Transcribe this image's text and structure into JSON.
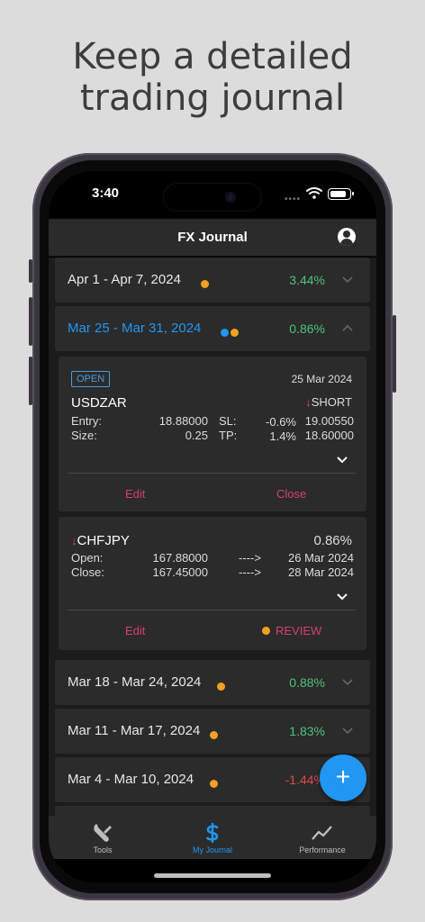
{
  "headline": {
    "line1": "Keep a detailed",
    "line2": "trading journal"
  },
  "status": {
    "time": "3:40"
  },
  "app": {
    "title": "FX Journal"
  },
  "colors": {
    "accent": "#2196f3",
    "positive": "#4ec27a",
    "negative": "#e04848",
    "pending": "#f5a020",
    "action": "#d6406e"
  },
  "weeks": [
    {
      "label": "Apr 1 - Apr 7, 2024",
      "pct": "3.44%",
      "dots": [
        "#f5a020"
      ],
      "expanded": false
    },
    {
      "label": "Mar 25 - Mar 31, 2024",
      "pct": "0.86%",
      "dots": [
        "#2196f3",
        "#f5a020"
      ],
      "expanded": true
    },
    {
      "label": "Mar 18 - Mar 24, 2024",
      "pct": "0.88%",
      "dots": [
        "#f5a020"
      ],
      "expanded": false
    },
    {
      "label": "Mar 11 - Mar 17, 2024",
      "pct": "1.83%",
      "dots": [
        "#f5a020"
      ],
      "expanded": false
    },
    {
      "label": "Mar 4 - Mar 10, 2024",
      "pct": "-1.44%",
      "dots": [
        "#f5a020"
      ],
      "expanded": false
    }
  ],
  "open_trade": {
    "badge": "OPEN",
    "date": "25 Mar 2024",
    "pair": "USDZAR",
    "direction": "SHORT",
    "entry_label": "Entry:",
    "entry": "18.88000",
    "size_label": "Size:",
    "size": "0.25",
    "sl_label": "SL:",
    "sl_pct": "-0.6%",
    "sl": "19.00550",
    "tp_label": "TP:",
    "tp_pct": "1.4%",
    "tp": "18.60000",
    "edit": "Edit",
    "close": "Close"
  },
  "closed_trade": {
    "pair": "CHFJPY",
    "pct": "0.86%",
    "open_label": "Open:",
    "open_price": "167.88000",
    "arrow1": "---->",
    "open_date": "26 Mar 2024",
    "close_label": "Close:",
    "close_price": "167.45000",
    "arrow2": "---->",
    "close_date": "28 Mar 2024",
    "edit": "Edit",
    "review": "REVIEW"
  },
  "tabs": [
    {
      "label": "Tools",
      "icon": "wrench-icon"
    },
    {
      "label": "My Journal",
      "icon": "dollar-icon",
      "active": true
    },
    {
      "label": "Performance",
      "icon": "trend-line-icon"
    }
  ]
}
